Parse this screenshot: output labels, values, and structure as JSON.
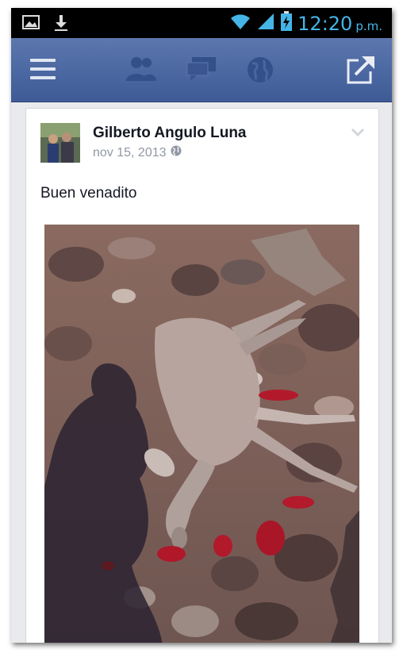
{
  "status_bar": {
    "time": "12:20",
    "ampm": "p.m.",
    "icons": [
      "image-icon",
      "download-icon",
      "wifi-icon",
      "signal-icon",
      "battery-charging-icon"
    ]
  },
  "header": {
    "icons": [
      "menu-icon",
      "friends-icon",
      "messages-icon",
      "globe-icon",
      "share-icon"
    ]
  },
  "post": {
    "author": "Gilberto Angulo Luna",
    "date": "nov 15, 2013",
    "privacy_icon": "globe-icon",
    "text": "Buen venadito",
    "photo_icon": "deer-photo"
  },
  "colors": {
    "header_top": "#5c77ae",
    "header_bottom": "#3e5b97",
    "time_blue": "#45b5e8",
    "background": "#e9eaed"
  }
}
